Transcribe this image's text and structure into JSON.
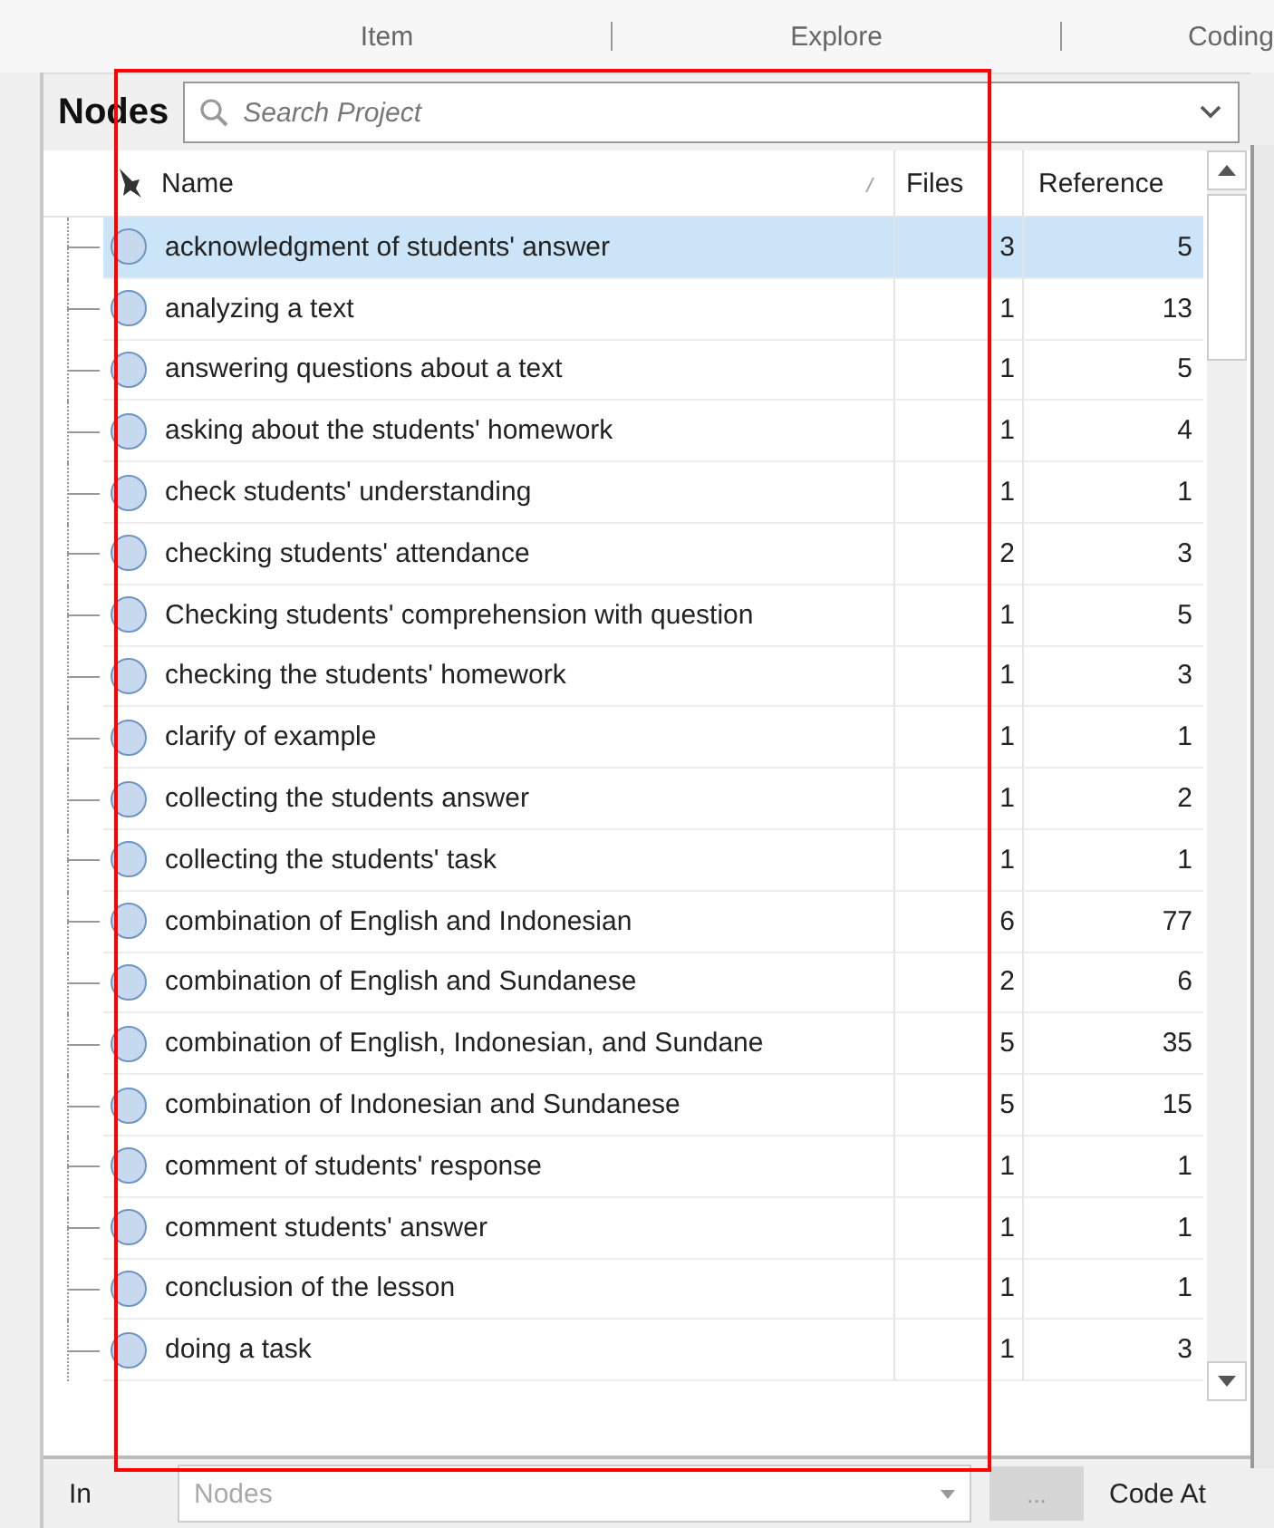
{
  "ribbon_tabs": [
    {
      "label": "Item"
    },
    {
      "label": "Explore"
    },
    {
      "label": "Coding"
    }
  ],
  "panel": {
    "title": "Nodes",
    "search": {
      "placeholder": "Search Project"
    }
  },
  "table": {
    "columns": [
      "Name",
      "Files",
      "Reference"
    ],
    "rows": [
      {
        "name": "acknowledgment of students' answer",
        "files": "3",
        "references": "5",
        "selected": true
      },
      {
        "name": "analyzing a text",
        "files": "1",
        "references": "13",
        "selected": false
      },
      {
        "name": "answering questions about a text",
        "files": "1",
        "references": "5",
        "selected": false
      },
      {
        "name": "asking about the students' homework",
        "files": "1",
        "references": "4",
        "selected": false
      },
      {
        "name": "check students' understanding",
        "files": "1",
        "references": "1",
        "selected": false
      },
      {
        "name": "checking students' attendance",
        "files": "2",
        "references": "3",
        "selected": false
      },
      {
        "name": "Checking students' comprehension with question",
        "files": "1",
        "references": "5",
        "selected": false
      },
      {
        "name": "checking the students' homework",
        "files": "1",
        "references": "3",
        "selected": false
      },
      {
        "name": "clarify of example",
        "files": "1",
        "references": "1",
        "selected": false
      },
      {
        "name": "collecting the students answer",
        "files": "1",
        "references": "2",
        "selected": false
      },
      {
        "name": "collecting the students' task",
        "files": "1",
        "references": "1",
        "selected": false
      },
      {
        "name": "combination of English and Indonesian",
        "files": "6",
        "references": "77",
        "selected": false
      },
      {
        "name": "combination of English and Sundanese",
        "files": "2",
        "references": "6",
        "selected": false
      },
      {
        "name": "combination of English, Indonesian, and Sundane",
        "files": "5",
        "references": "35",
        "selected": false
      },
      {
        "name": "combination of Indonesian and Sundanese",
        "files": "5",
        "references": "15",
        "selected": false
      },
      {
        "name": "comment of students' response",
        "files": "1",
        "references": "1",
        "selected": false
      },
      {
        "name": "comment students' answer",
        "files": "1",
        "references": "1",
        "selected": false
      },
      {
        "name": "conclusion of the lesson",
        "files": "1",
        "references": "1",
        "selected": false
      },
      {
        "name": "doing a task",
        "files": "1",
        "references": "3",
        "selected": false
      }
    ]
  },
  "footer": {
    "label": "In",
    "scope": {
      "value": "Nodes",
      "disabled": true
    },
    "browse_button": {
      "label": "...",
      "disabled": true
    },
    "action": "Code At"
  },
  "annotation": {
    "kind": "rectangle",
    "color": "#ff0000"
  }
}
